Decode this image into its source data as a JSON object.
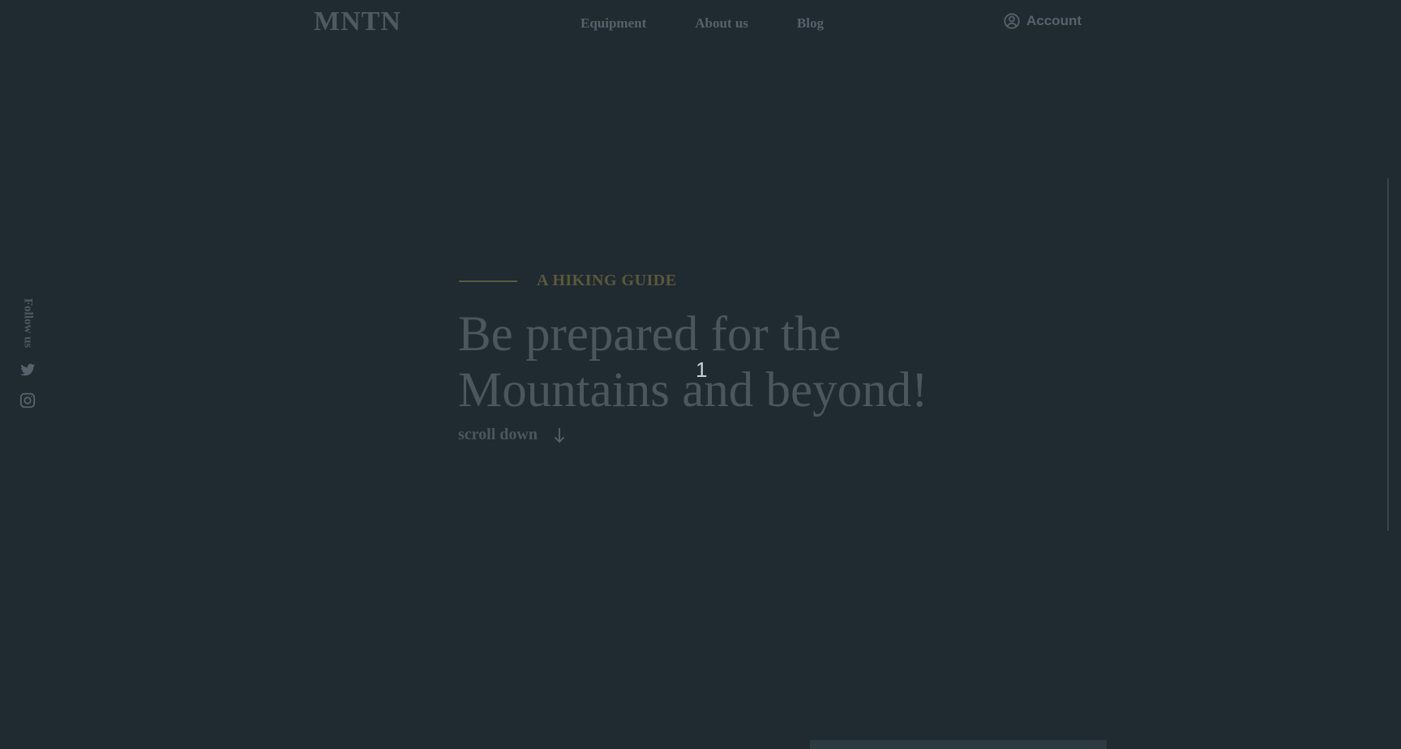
{
  "brand": {
    "logo": "MNTN"
  },
  "navigation": {
    "items": [
      {
        "label": "Equipment"
      },
      {
        "label": "About us"
      },
      {
        "label": "Blog"
      }
    ]
  },
  "account": {
    "label": "Account",
    "icon": "account-icon"
  },
  "social": {
    "label": "Follow us",
    "items": [
      {
        "name": "twitter",
        "icon": "twitter-icon"
      },
      {
        "name": "instagram",
        "icon": "instagram-icon"
      }
    ]
  },
  "hero": {
    "kicker": "A HIKING GUIDE",
    "title_line_1": "Be prepared for the",
    "title_line_2": "Mountains and beyond!",
    "scroll_label": "scroll down",
    "scroll_icon": "arrow-down-icon",
    "page_number": "1"
  },
  "theme": {
    "background": "#202a31",
    "text_muted": "#56636a",
    "accent": "#5b583b"
  }
}
